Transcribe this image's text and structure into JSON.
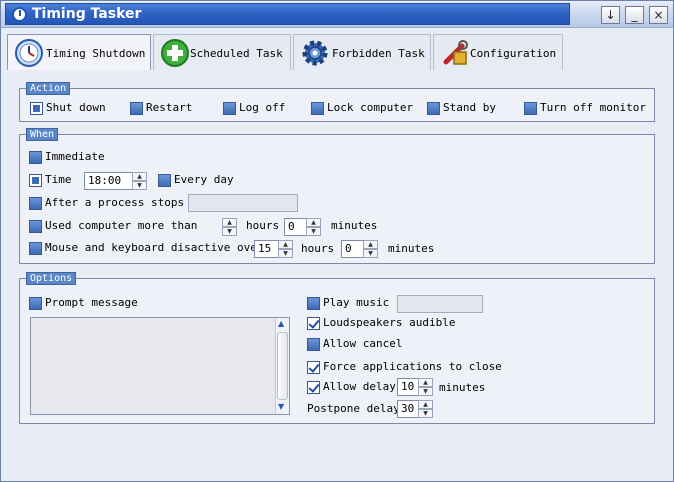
{
  "window": {
    "title": "Timing Tasker",
    "buttons": [
      "↓",
      "_",
      "×"
    ]
  },
  "tabs": [
    {
      "label": "Timing Shutdown",
      "icon": "clock-icon",
      "active": true
    },
    {
      "label": "Scheduled Task",
      "icon": "plus-icon",
      "active": false
    },
    {
      "label": "Forbidden Task",
      "icon": "gear-icon",
      "active": false
    },
    {
      "label": "Configuration",
      "icon": "tools-icon",
      "active": false
    }
  ],
  "action": {
    "legend": "Action",
    "items": [
      "Shut down",
      "Restart",
      "Log off",
      "Lock computer",
      "Stand by",
      "Turn off monitor"
    ]
  },
  "when": {
    "legend": "When",
    "immediate": "Immediate",
    "time_label": "Time",
    "time_value": "18:00",
    "every_day": "Every day",
    "after_process": "After a process stops",
    "after_process_value": "",
    "used_more_than": "Used computer more than",
    "used_hours_value": "",
    "hours": "hours",
    "used_minutes_value": "0",
    "minutes": "minutes",
    "inactive": "Mouse and keyboard disactive over",
    "inactive_hours_value": "15",
    "inactive_minutes_value": "0"
  },
  "options": {
    "legend": "Options",
    "prompt_message": "Prompt message",
    "prompt_text": "",
    "play_music": "Play music",
    "music_value": "",
    "loudspeakers": "Loudspeakers audible",
    "allow_cancel": "Allow cancel",
    "force_close": "Force applications to close",
    "allow_delay": "Allow delay",
    "allow_delay_value": "10",
    "minutes": "minutes",
    "postpone_delay": "Postpone delay",
    "postpone_value": "30"
  },
  "colors": {
    "title_bar": "#2f63c4",
    "legend_bg": "#5b87c8",
    "window_bg": "#e8ecf4"
  }
}
